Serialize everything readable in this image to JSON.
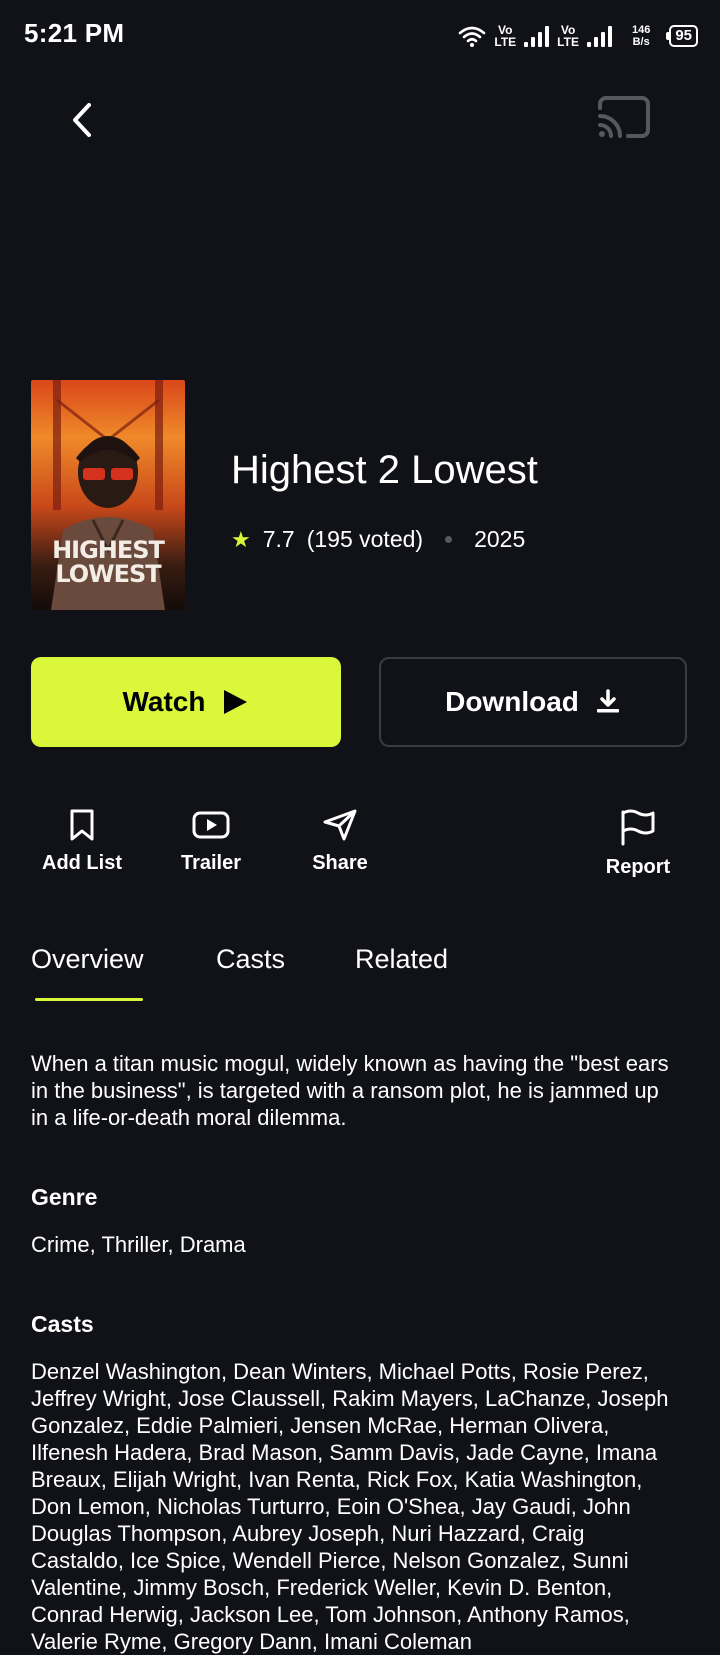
{
  "status": {
    "time": "5:21 PM",
    "vo1": "Vo",
    "lte1": "LTE",
    "vo2": "Vo",
    "lte2": "LTE",
    "speed_value": "146",
    "speed_unit": "B/s",
    "battery": "95"
  },
  "movie": {
    "title": "Highest 2 Lowest",
    "rating": "7.7",
    "votes": "(195 voted)",
    "year": "2025",
    "poster_text": "HIGHEST LOWEST"
  },
  "buttons": {
    "watch": "Watch",
    "download": "Download"
  },
  "actions": {
    "add_list": "Add List",
    "trailer": "Trailer",
    "share": "Share",
    "report": "Report"
  },
  "tabs": [
    "Overview",
    "Casts",
    "Related"
  ],
  "overview": {
    "description": "When a titan music mogul, widely known as having the \"best ears in the business\", is targeted with a ransom plot, he is jammed up in a life-or-death moral dilemma.",
    "genre_heading": "Genre",
    "genre": "Crime, Thriller, Drama",
    "casts_heading": "Casts",
    "casts": "Denzel Washington, Dean Winters, Michael Potts, Rosie Perez, Jeffrey Wright, Jose Claussell, Rakim Mayers, LaChanze, Joseph Gonzalez, Eddie Palmieri, Jensen McRae, Herman Olivera, Ilfenesh Hadera, Brad Mason, Samm Davis, Jade Cayne, Imana Breaux, Elijah Wright, Ivan Renta, Rick Fox, Katia Washington, Don Lemon, Nicholas Turturro, Eoin O'Shea, Jay Gaudi, John Douglas Thompson, Aubrey Joseph, Nuri Hazzard, Craig Castaldo, Ice Spice, Wendell Pierce, Nelson Gonzalez, Sunni Valentine, Jimmy Bosch, Frederick Weller, Kevin D. Benton, Conrad Herwig, Jackson Lee, Tom Johnson, Anthony Ramos, Valerie Ryme, Gregory Dann, Imani Coleman"
  },
  "colors": {
    "accent": "#dbf73a",
    "background": "#111217"
  }
}
